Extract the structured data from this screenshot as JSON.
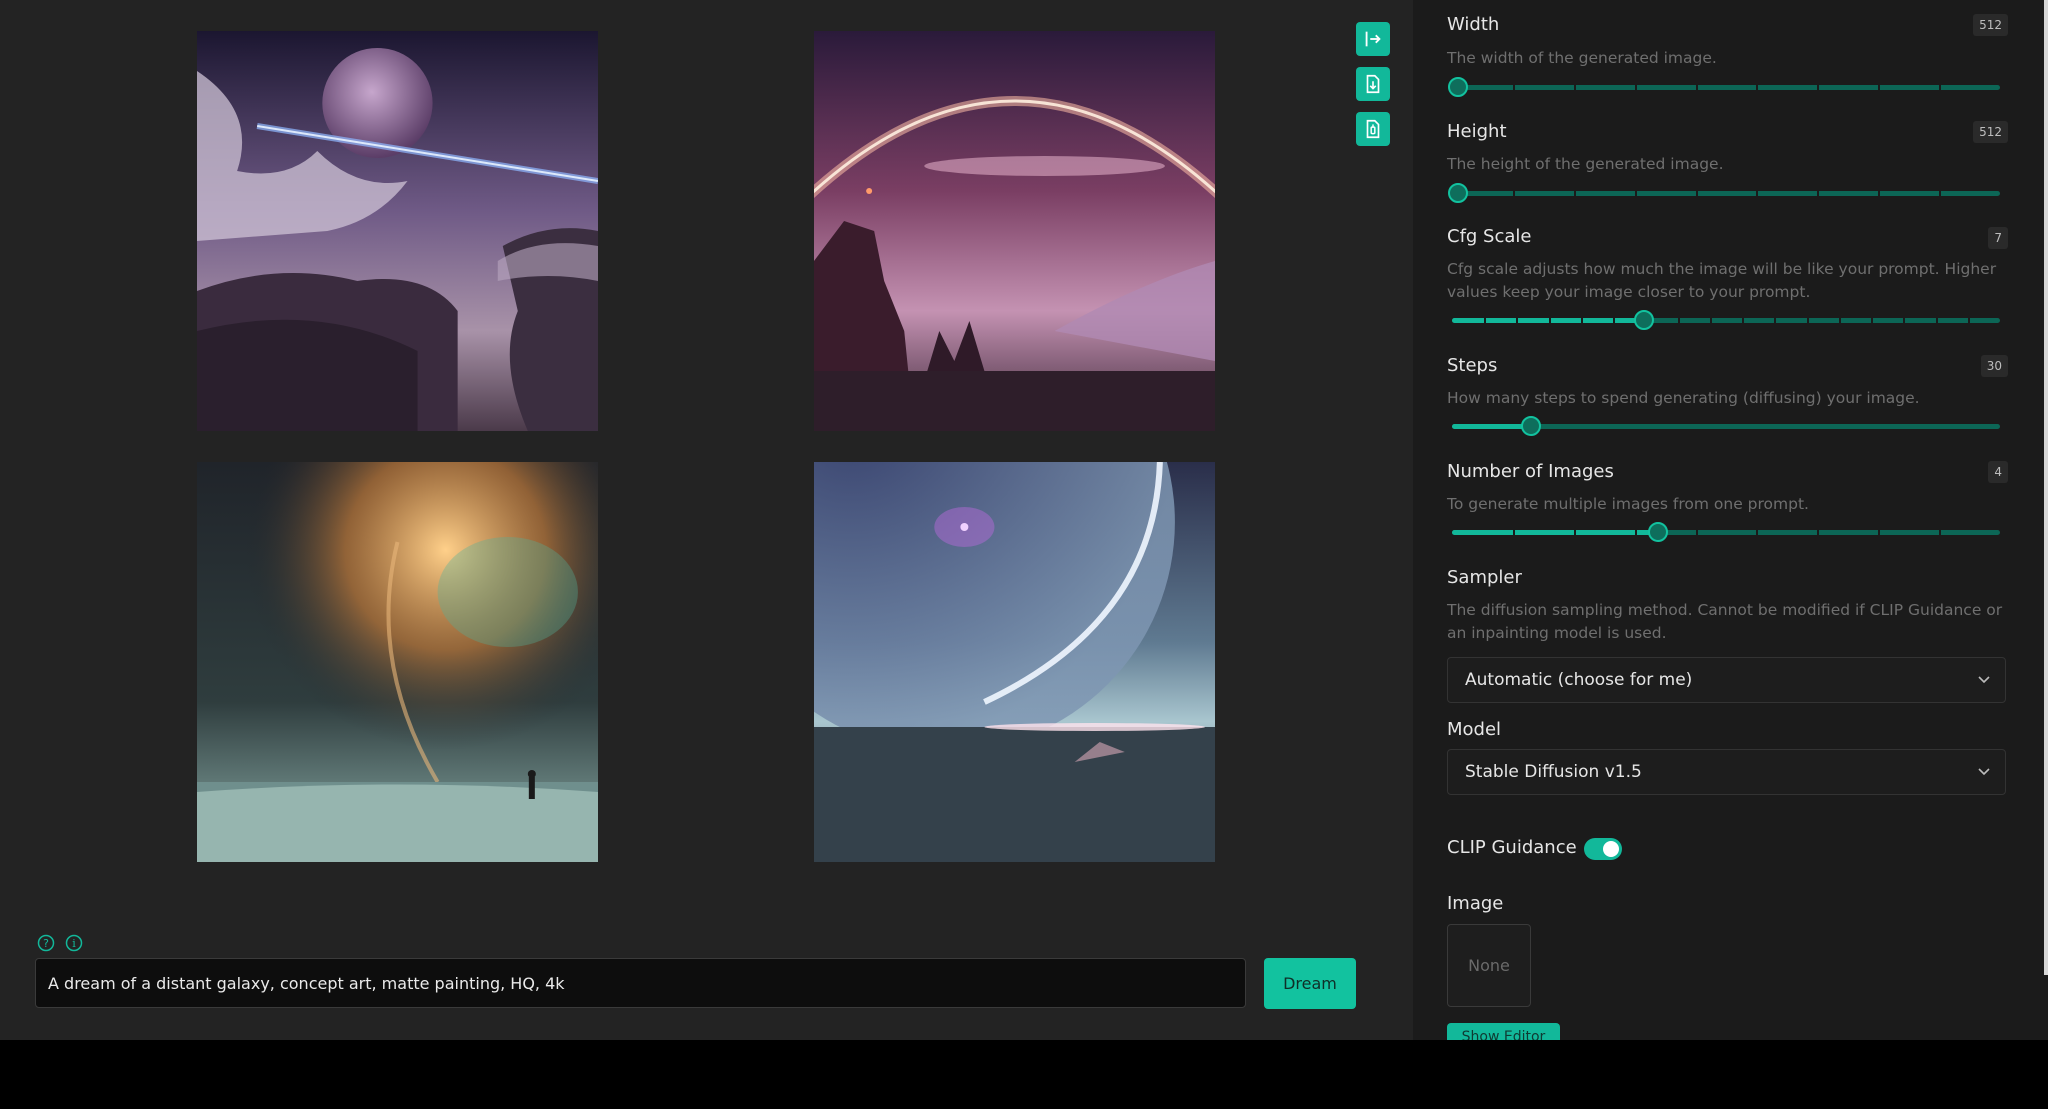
{
  "toolbar": {
    "icons": [
      "exit-to-right-icon",
      "download-file-icon",
      "clipboard-file-icon"
    ]
  },
  "colors": {
    "accent": "#12b89a",
    "background": "#232323",
    "sidebar": "#1b1b1b"
  },
  "prompt": {
    "value": "A dream of a distant galaxy, concept art, matte painting, HQ, 4k",
    "submit_label": "Dream"
  },
  "settings": {
    "width": {
      "label": "Width",
      "value": "512",
      "description": "The width of the generated image.",
      "level": 0.0
    },
    "height": {
      "label": "Height",
      "value": "512",
      "description": "The height of the generated image.",
      "level": 0.0
    },
    "cfg_scale": {
      "label": "Cfg Scale",
      "value": "7",
      "description": "Cfg scale adjusts how much the image will be like your prompt. Higher values keep your image closer to your prompt.",
      "level": 0.35
    },
    "steps": {
      "label": "Steps",
      "value": "30",
      "description": "How many steps to spend generating (diffusing) your image.",
      "level": 0.145
    },
    "num_images": {
      "label": "Number of Images",
      "value": "4",
      "description": "To generate multiple images from one prompt.",
      "level": 0.375
    },
    "sampler": {
      "label": "Sampler",
      "description": "The diffusion sampling method. Cannot be modified if CLIP Guidance or an inpainting model is used.",
      "selected": "Automatic (choose for me)"
    },
    "model": {
      "label": "Model",
      "selected": "Stable Diffusion v1.5"
    },
    "clip_guidance": {
      "label": "CLIP Guidance",
      "enabled": true
    },
    "image": {
      "label": "Image",
      "value": "None",
      "editor_button": "Show Editor"
    }
  }
}
